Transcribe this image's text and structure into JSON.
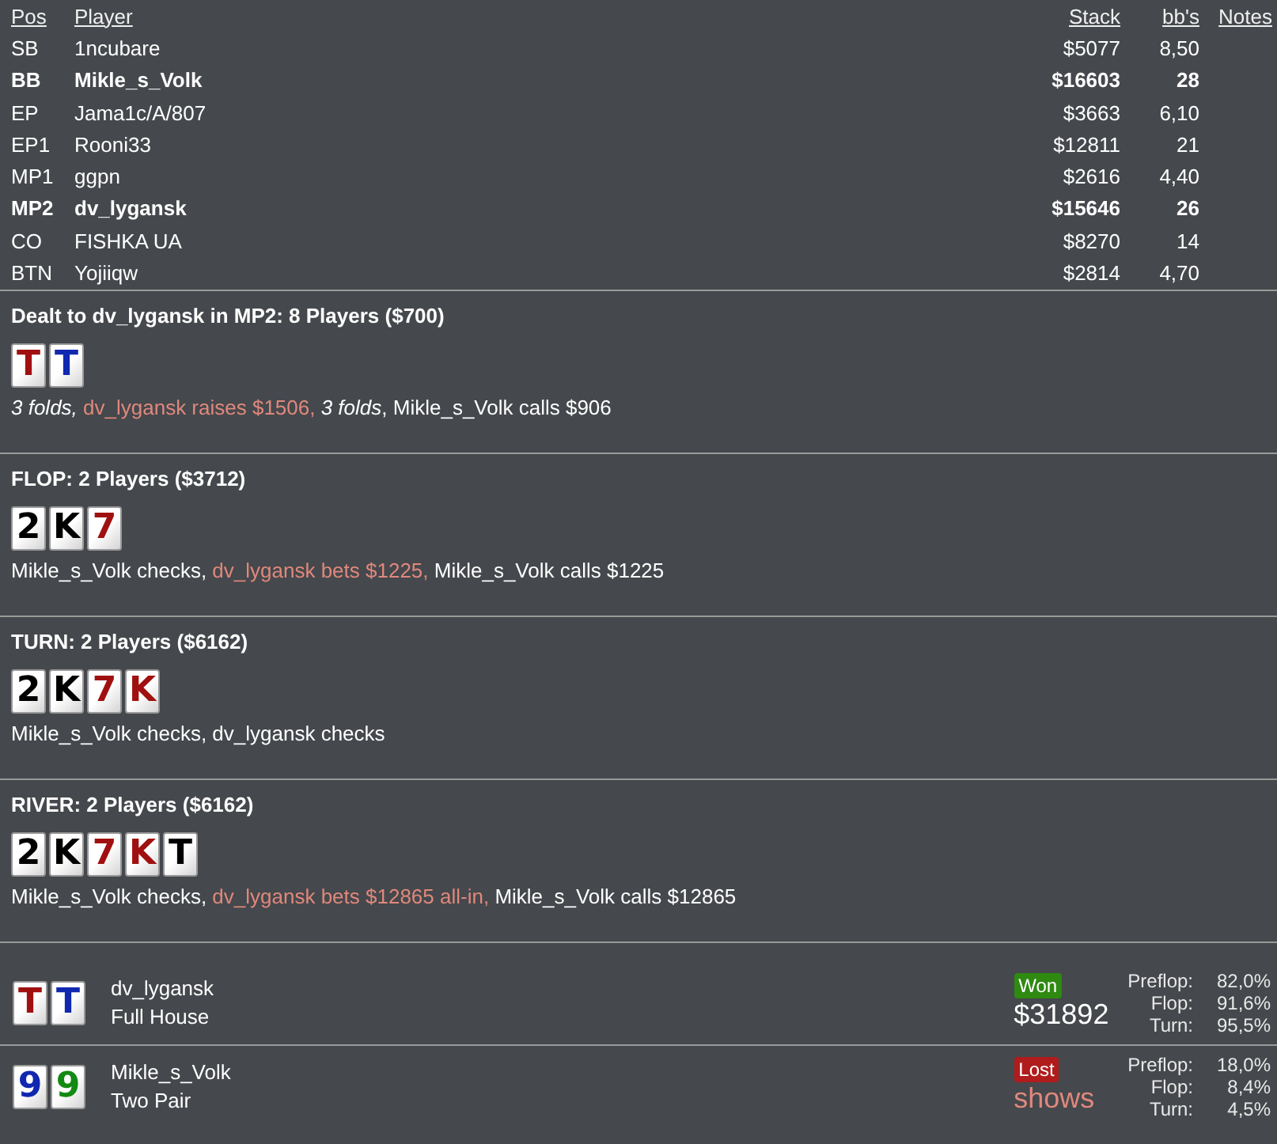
{
  "players_table": {
    "columns": [
      "Pos",
      "Player",
      "Stack",
      "bb's",
      "Notes"
    ],
    "rows": [
      {
        "pos": "SB",
        "player": "1ncubare",
        "stack": "$5077",
        "bbs": "8,50",
        "highlighted": false
      },
      {
        "pos": "BB",
        "player": "Mikle_s_Volk",
        "stack": "$16603",
        "bbs": "28",
        "highlighted": true
      },
      {
        "pos": "EP",
        "player": "Jama1c/A/807",
        "stack": "$3663",
        "bbs": "6,10",
        "highlighted": false
      },
      {
        "pos": "EP1",
        "player": "Rooni33",
        "stack": "$12811",
        "bbs": "21",
        "highlighted": false
      },
      {
        "pos": "MP1",
        "player": "ggpn",
        "stack": "$2616",
        "bbs": "4,40",
        "highlighted": false
      },
      {
        "pos": "MP2",
        "player": "dv_lygansk",
        "stack": "$15646",
        "bbs": "26",
        "highlighted": true
      },
      {
        "pos": "CO",
        "player": "FISHKA UA",
        "stack": "$8270",
        "bbs": "14",
        "highlighted": false
      },
      {
        "pos": "BTN",
        "player": "Yojiiqw",
        "stack": "$2814",
        "bbs": "4,70",
        "highlighted": false
      }
    ]
  },
  "streets": [
    {
      "title": "Dealt to dv_lygansk in MP2: 8 Players ($700)",
      "cards": [
        {
          "rank": "T",
          "color": "#a01010"
        },
        {
          "rank": "T",
          "color": "#1028b0"
        }
      ],
      "actions": [
        {
          "text": "3 folds, ",
          "kind": "fold"
        },
        {
          "text": "dv_lygansk raises $1506, ",
          "kind": "hero"
        },
        {
          "text": "3 folds",
          "kind": "fold"
        },
        {
          "text": ", Mikle_s_Volk calls $906",
          "kind": "plain"
        }
      ]
    },
    {
      "title": "FLOP: 2 Players ($3712)",
      "cards": [
        {
          "rank": "2",
          "color": "#000000"
        },
        {
          "rank": "K",
          "color": "#000000"
        },
        {
          "rank": "7",
          "color": "#a01010"
        }
      ],
      "actions": [
        {
          "text": "Mikle_s_Volk checks, ",
          "kind": "plain"
        },
        {
          "text": "dv_lygansk bets $1225, ",
          "kind": "hero"
        },
        {
          "text": "Mikle_s_Volk calls $1225",
          "kind": "plain"
        }
      ]
    },
    {
      "title": "TURN: 2 Players ($6162)",
      "cards": [
        {
          "rank": "2",
          "color": "#000000"
        },
        {
          "rank": "K",
          "color": "#000000"
        },
        {
          "rank": "7",
          "color": "#a01010"
        },
        {
          "rank": "K",
          "color": "#a01010"
        }
      ],
      "actions": [
        {
          "text": "Mikle_s_Volk checks, dv_lygansk checks",
          "kind": "plain"
        }
      ]
    },
    {
      "title": "RIVER: 2 Players ($6162)",
      "cards": [
        {
          "rank": "2",
          "color": "#000000"
        },
        {
          "rank": "K",
          "color": "#000000"
        },
        {
          "rank": "7",
          "color": "#a01010"
        },
        {
          "rank": "K",
          "color": "#a01010"
        },
        {
          "rank": "T",
          "color": "#000000"
        }
      ],
      "actions": [
        {
          "text": "Mikle_s_Volk checks, ",
          "kind": "plain"
        },
        {
          "text": "dv_lygansk bets $12865 all-in, ",
          "kind": "hero"
        },
        {
          "text": "Mikle_s_Volk calls $12865",
          "kind": "plain"
        }
      ]
    }
  ],
  "results": [
    {
      "cards": [
        {
          "rank": "T",
          "color": "#a01010"
        },
        {
          "rank": "T",
          "color": "#1028b0"
        }
      ],
      "player": "dv_lygansk",
      "hand": "Full House",
      "outcome": {
        "kind": "won",
        "label": "Won"
      },
      "amount": "$31892",
      "equity": [
        {
          "label": "Preflop:",
          "value": "82,0%"
        },
        {
          "label": "Flop:",
          "value": "91,6%"
        },
        {
          "label": "Turn:",
          "value": "95,5%"
        }
      ]
    },
    {
      "cards": [
        {
          "rank": "9",
          "color": "#1028b0"
        },
        {
          "rank": "9",
          "color": "#138a13"
        }
      ],
      "player": "Mikle_s_Volk",
      "hand": "Two Pair",
      "outcome": {
        "kind": "lost",
        "label": "Lost"
      },
      "amount": "shows",
      "equity": [
        {
          "label": "Preflop:",
          "value": "18,0%"
        },
        {
          "label": "Flop:",
          "value": "8,4%"
        },
        {
          "label": "Turn:",
          "value": "4,5%"
        }
      ]
    }
  ]
}
